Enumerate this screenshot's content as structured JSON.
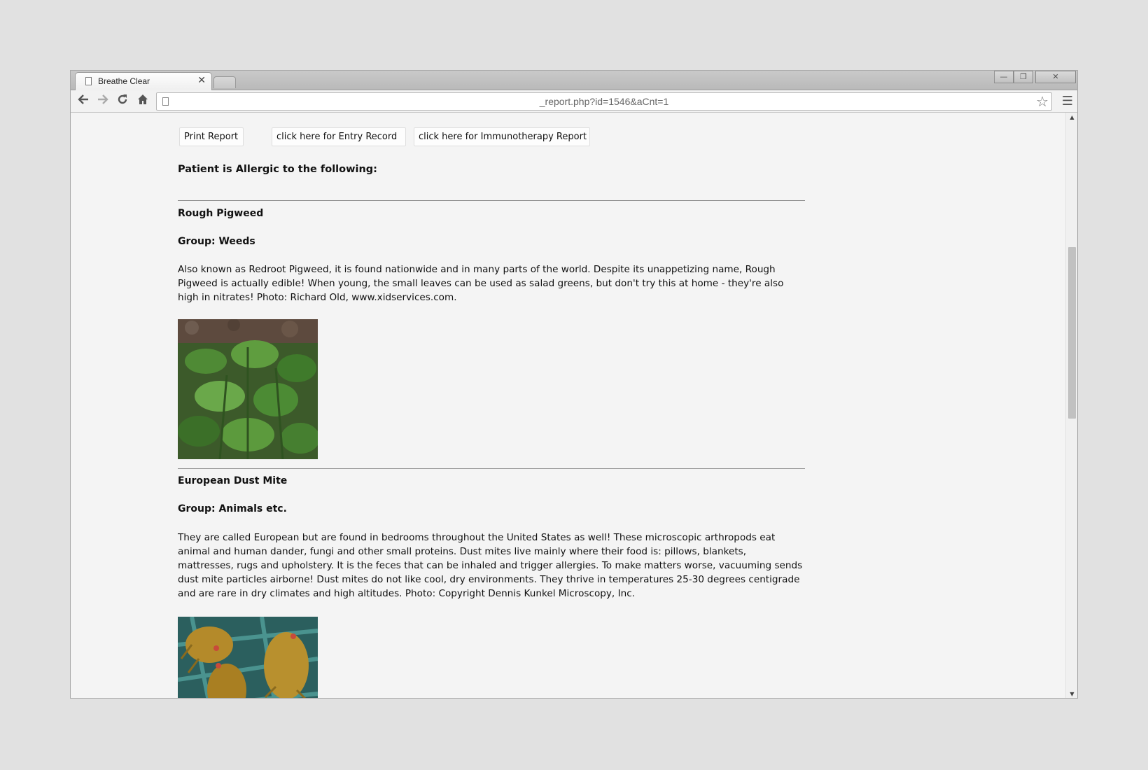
{
  "browser": {
    "tab_title": "Breathe Clear",
    "tab_close": "✕",
    "url": "_report.php?id=1546&aCnt=1",
    "window_controls": {
      "minimize": "—",
      "maximize": "❐",
      "close": "✕"
    },
    "icons": {
      "back": "back-arrow-icon",
      "forward": "forward-arrow-icon",
      "reload": "reload-icon",
      "home": "home-icon",
      "star": "bookmark-star-icon",
      "menu": "menu-icon"
    }
  },
  "report": {
    "buttons": {
      "print": "Print Report",
      "entry": "click here for Entry Record",
      "immuno": "click here for Immunotherapy Report"
    },
    "heading": "Patient is Allergic to the following:",
    "allergens": [
      {
        "name": "Rough Pigweed",
        "group": "Group: Weeds",
        "description": "Also known as Redroot Pigweed, it is found nationwide and in many parts of the world. Despite its unappetizing name, Rough Pigweed is actually edible! When young, the small leaves can be used as salad greens, but don't try this at home - they're also high in nitrates! Photo: Richard Old, www.xidservices.com.",
        "photo": "pigweed-photo"
      },
      {
        "name": "European Dust Mite",
        "group": "Group: Animals etc.",
        "description": "They are called European but are found in bedrooms throughout the United States as well! These microscopic arthropods eat animal and human dander, fungi and other small proteins. Dust mites live mainly where their food is: pillows, blankets, mattresses, rugs and upholstery. It is the feces that can be inhaled and trigger allergies. To make matters worse, vacuuming sends dust mite particles airborne! Dust mites do not like cool, dry environments. They thrive in temperatures 25-30 degrees centigrade and are rare in dry climates and high altitudes. Photo: Copyright Dennis Kunkel Microscopy, Inc.",
        "photo": "dust-mite-photo"
      }
    ]
  },
  "colors": {
    "page_bg": "#f4f4f4",
    "desktop_bg": "#e1e1e1"
  }
}
